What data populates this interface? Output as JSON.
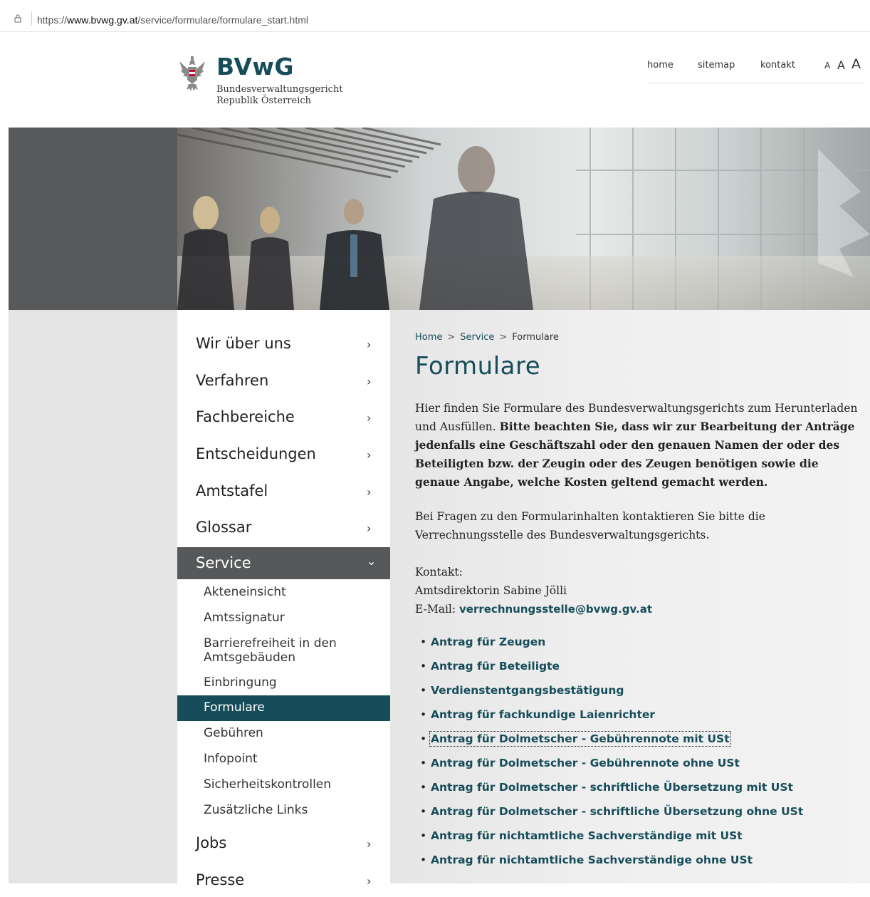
{
  "browser": {
    "url_prefix": "https://",
    "url_domain": "www.bvwg.gv.at",
    "url_path": "/service/formulare/formulare_start.html"
  },
  "header": {
    "logo_name": "BVwG",
    "logo_line1": "Bundesverwaltungsgericht",
    "logo_line2": "Republik Österreich",
    "nav": [
      "home",
      "sitemap",
      "kontakt"
    ],
    "font_sizes": [
      "A",
      "A",
      "A"
    ]
  },
  "sidebar": {
    "items": [
      {
        "label": "Wir über uns"
      },
      {
        "label": "Verfahren"
      },
      {
        "label": "Fachbereiche"
      },
      {
        "label": "Entscheidungen"
      },
      {
        "label": "Amtstafel"
      },
      {
        "label": "Glossar"
      },
      {
        "label": "Service"
      }
    ],
    "chevron_right": "›",
    "chevron_down": "⌄",
    "subitems": [
      {
        "label": "Akteneinsicht"
      },
      {
        "label": "Amtssignatur"
      },
      {
        "label": "Barrierefreiheit in den Amtsgebäuden"
      },
      {
        "label": "Einbringung"
      },
      {
        "label": "Formulare"
      },
      {
        "label": "Gebühren"
      },
      {
        "label": "Infopoint"
      },
      {
        "label": "Sicherheitskontrollen"
      },
      {
        "label": "Zusätzliche Links"
      }
    ],
    "after_items": [
      {
        "label": "Jobs"
      },
      {
        "label": "Presse"
      }
    ]
  },
  "breadcrumb": {
    "home": "Home",
    "service": "Service",
    "current": "Formulare",
    "separator": ">"
  },
  "main": {
    "title": "Formulare",
    "intro_plain": "Hier finden Sie Formulare des Bundesverwaltungsgerichts zum Herunterladen und Ausfüllen. ",
    "intro_bold": "Bitte beachten Sie, dass wir zur Bearbeitung der Anträge jedenfalls eine Geschäftszahl oder den genauen Namen der oder des Beteiligten bzw. der Zeugin oder des Zeugen benötigen sowie die genaue Angabe, welche Kosten geltend gemacht werden.",
    "questions": "Bei Fragen zu den Formularinhalten kontaktieren Sie bitte die Verrechnungsstelle des Bundesverwaltungsgerichts.",
    "contact_label": "Kontakt:",
    "contact_name": "Amtsdirektorin Sabine Jölli",
    "email_label": "E-Mail: ",
    "email": "verrechnungsstelle@bvwg.gv.at",
    "links": [
      "Antrag für Zeugen",
      "Antrag für Beteiligte",
      "Verdienstentgangsbestätigung",
      "Antrag für fachkundige Laienrichter",
      "Antrag für Dolmetscher - Gebührennote mit USt",
      "Antrag für Dolmetscher - Gebührennote ohne USt",
      "Antrag für Dolmetscher - schriftliche Übersetzung mit USt",
      "Antrag für Dolmetscher - schriftliche Übersetzung ohne USt",
      "Antrag für nichtamtliche Sachverständige mit USt",
      "Antrag für nichtamtliche Sachverständige ohne USt"
    ],
    "bullet": "•"
  },
  "colors": {
    "brand": "#174d5a",
    "sidebar_active": "#56585a",
    "hero_left": "#57595b"
  }
}
